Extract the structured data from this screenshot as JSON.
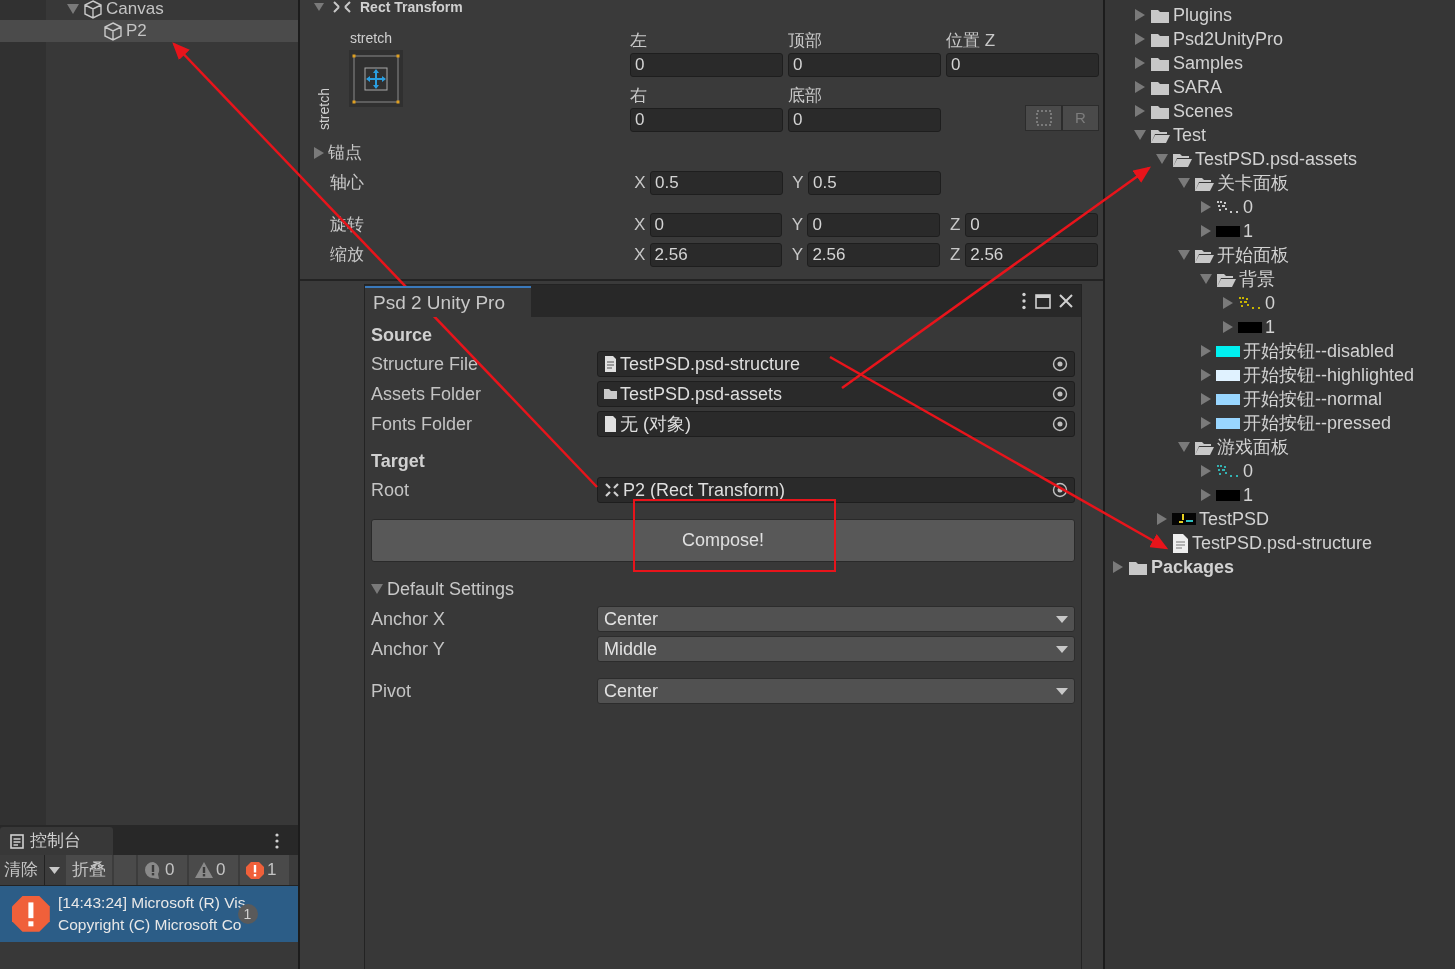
{
  "hierarchy": {
    "items": [
      {
        "label": "Canvas",
        "expanded": true,
        "selected": false,
        "children": [
          {
            "label": "P2",
            "selected": true
          }
        ]
      }
    ]
  },
  "rect_transform": {
    "title": "Rect Transform",
    "anchor_preset": {
      "top_label": "stretch",
      "side_label": "stretch"
    },
    "position_rows": [
      {
        "fields": [
          {
            "label": "左",
            "value": "0"
          },
          {
            "label": "顶部",
            "value": "0"
          },
          {
            "label": "位置 Z",
            "value": "0"
          }
        ]
      },
      {
        "fields": [
          {
            "label": "右",
            "value": "0"
          },
          {
            "label": "底部",
            "value": "0"
          }
        ]
      }
    ],
    "raw_edit_button": "R",
    "anchors": {
      "label": "锚点",
      "expanded": false
    },
    "pivot": {
      "label": "轴心",
      "values": [
        {
          "axis": "X",
          "value": "0.5"
        },
        {
          "axis": "Y",
          "value": "0.5"
        }
      ]
    },
    "rotation": {
      "label": "旋转",
      "values": [
        {
          "axis": "X",
          "value": "0"
        },
        {
          "axis": "Y",
          "value": "0"
        },
        {
          "axis": "Z",
          "value": "0"
        }
      ]
    },
    "scale": {
      "label": "缩放",
      "values": [
        {
          "axis": "X",
          "value": "2.56"
        },
        {
          "axis": "Y",
          "value": "2.56"
        },
        {
          "axis": "Z",
          "value": "2.56"
        }
      ]
    }
  },
  "psd_window": {
    "tab": "Psd 2 Unity Pro",
    "sections": [
      {
        "heading": "Source",
        "rows": [
          {
            "label": "Structure File",
            "value": "TestPSD.psd-structure",
            "kind": "text-file"
          },
          {
            "label": "Assets Folder",
            "value": "TestPSD.psd-assets",
            "kind": "folder"
          },
          {
            "label": "Fonts Folder",
            "value": "无 (对象)",
            "kind": "empty-file"
          }
        ]
      },
      {
        "heading": "Target",
        "rows": [
          {
            "label": "Root",
            "value": "P2 (Rect Transform)",
            "kind": "rect-transform"
          }
        ]
      }
    ],
    "compose_button": "Compose!",
    "default_settings": {
      "label": "Default Settings",
      "expanded": true,
      "rows": [
        {
          "label": "Anchor X",
          "value": "Center"
        },
        {
          "label": "Anchor Y",
          "value": "Middle"
        },
        {
          "label": "Pivot",
          "value": "Center"
        }
      ]
    }
  },
  "console": {
    "tab": "控制台",
    "clear_button": "清除",
    "collapse_button": "折叠",
    "counters": [
      {
        "kind": "info",
        "count": "0"
      },
      {
        "kind": "warning",
        "count": "0"
      },
      {
        "kind": "error",
        "count": "1"
      }
    ],
    "entries": [
      {
        "kind": "error",
        "selected": true,
        "lines": [
          "[14:43:24] Microsoft (R) Vis",
          "Copyright (C) Microsoft Co"
        ],
        "count": "1"
      }
    ]
  },
  "project": {
    "items": [
      {
        "label": "Plugins",
        "kind": "folder",
        "expanded": false
      },
      {
        "label": "Psd2UnityPro",
        "kind": "folder",
        "expanded": false
      },
      {
        "label": "Samples",
        "kind": "folder",
        "expanded": false
      },
      {
        "label": "SARA",
        "kind": "folder",
        "expanded": false
      },
      {
        "label": "Scenes",
        "kind": "folder",
        "expanded": false
      },
      {
        "label": "Test",
        "kind": "folder",
        "expanded": true,
        "children": [
          {
            "label": "TestPSD.psd-assets",
            "kind": "folder",
            "expanded": true,
            "children": [
              {
                "label": "关卡面板",
                "kind": "folder",
                "expanded": true,
                "children": [
                  {
                    "label": "0",
                    "kind": "sprite-dots",
                    "color": "#c8c8c8",
                    "expanded": false
                  },
                  {
                    "label": "1",
                    "kind": "sprite",
                    "color": "#000000",
                    "expanded": false
                  }
                ]
              },
              {
                "label": "开始面板",
                "kind": "folder",
                "expanded": true,
                "children": [
                  {
                    "label": "背景",
                    "kind": "folder",
                    "expanded": true,
                    "children": [
                      {
                        "label": "0",
                        "kind": "sprite-dots",
                        "color": "#c8b400",
                        "expanded": false
                      },
                      {
                        "label": "1",
                        "kind": "sprite",
                        "color": "#000000",
                        "expanded": false
                      }
                    ]
                  },
                  {
                    "label": "开始按钮--disabled",
                    "kind": "sprite",
                    "color": "#00f0f0",
                    "expanded": false
                  },
                  {
                    "label": "开始按钮--highlighted",
                    "kind": "sprite",
                    "color": "#e0f2ff",
                    "expanded": false
                  },
                  {
                    "label": "开始按钮--normal",
                    "kind": "sprite",
                    "color": "#99d6ff",
                    "expanded": false
                  },
                  {
                    "label": "开始按钮--pressed",
                    "kind": "sprite",
                    "color": "#99d6ff",
                    "expanded": false
                  }
                ]
              },
              {
                "label": "游戏面板",
                "kind": "folder",
                "expanded": true,
                "children": [
                  {
                    "label": "0",
                    "kind": "sprite-dots",
                    "color": "#33b3b3",
                    "expanded": false
                  },
                  {
                    "label": "1",
                    "kind": "sprite",
                    "color": "#000000",
                    "expanded": false
                  }
                ]
              }
            ]
          },
          {
            "label": "TestPSD",
            "kind": "prefab",
            "expanded": false
          },
          {
            "label": "TestPSD.psd-structure",
            "kind": "file"
          }
        ]
      }
    ],
    "root_items": [
      {
        "label": "Packages",
        "kind": "folder",
        "expanded": false
      }
    ]
  }
}
